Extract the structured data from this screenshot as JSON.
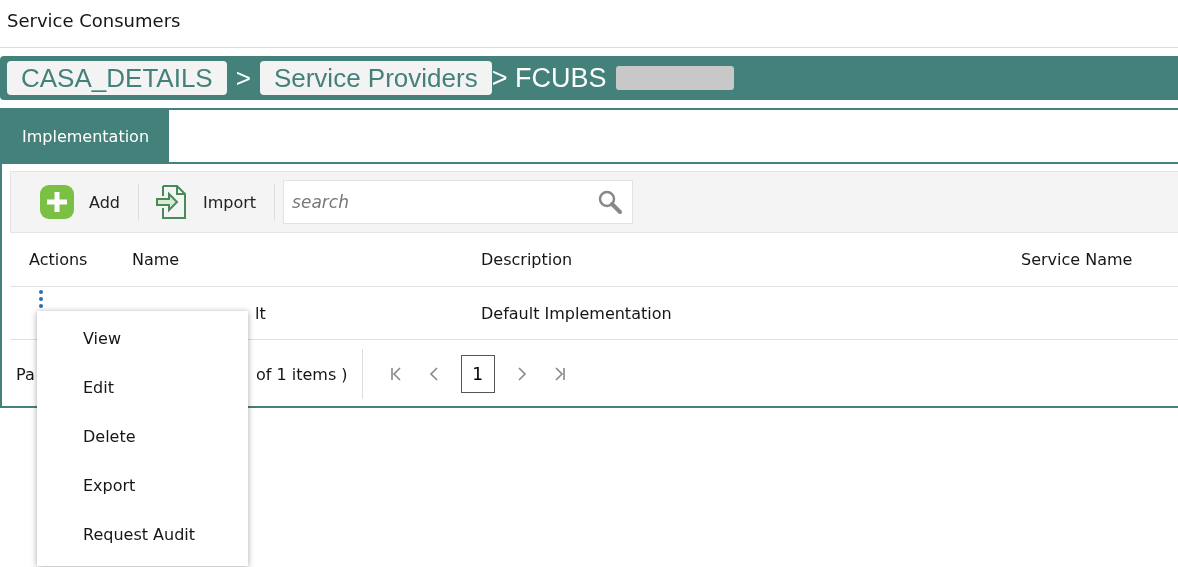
{
  "page_title": "Service Consumers",
  "breadcrumb": {
    "links": [
      "CASA_DETAILS",
      "Service Providers"
    ],
    "separator": ">",
    "current": "> FCUBS"
  },
  "tabs": [
    {
      "label": "Implementation",
      "selected": true
    }
  ],
  "toolbar": {
    "buttons": [
      {
        "label": "Add",
        "kind": "add"
      },
      {
        "label": "Import",
        "kind": "import"
      }
    ],
    "search": {
      "placeholder": "search"
    }
  },
  "table": {
    "columns": [
      "Actions",
      "Name",
      "Description",
      "Service Name"
    ],
    "rows": [
      {
        "name": "lt",
        "description": "Default Implementation"
      }
    ]
  },
  "pager": {
    "label": "Pa",
    "summary": "of 1 items )",
    "pages": [
      {
        "label": "1",
        "selected": true
      }
    ]
  },
  "context_menu": [
    "View",
    "Edit",
    "Delete",
    "Export",
    "Request Audit"
  ]
}
